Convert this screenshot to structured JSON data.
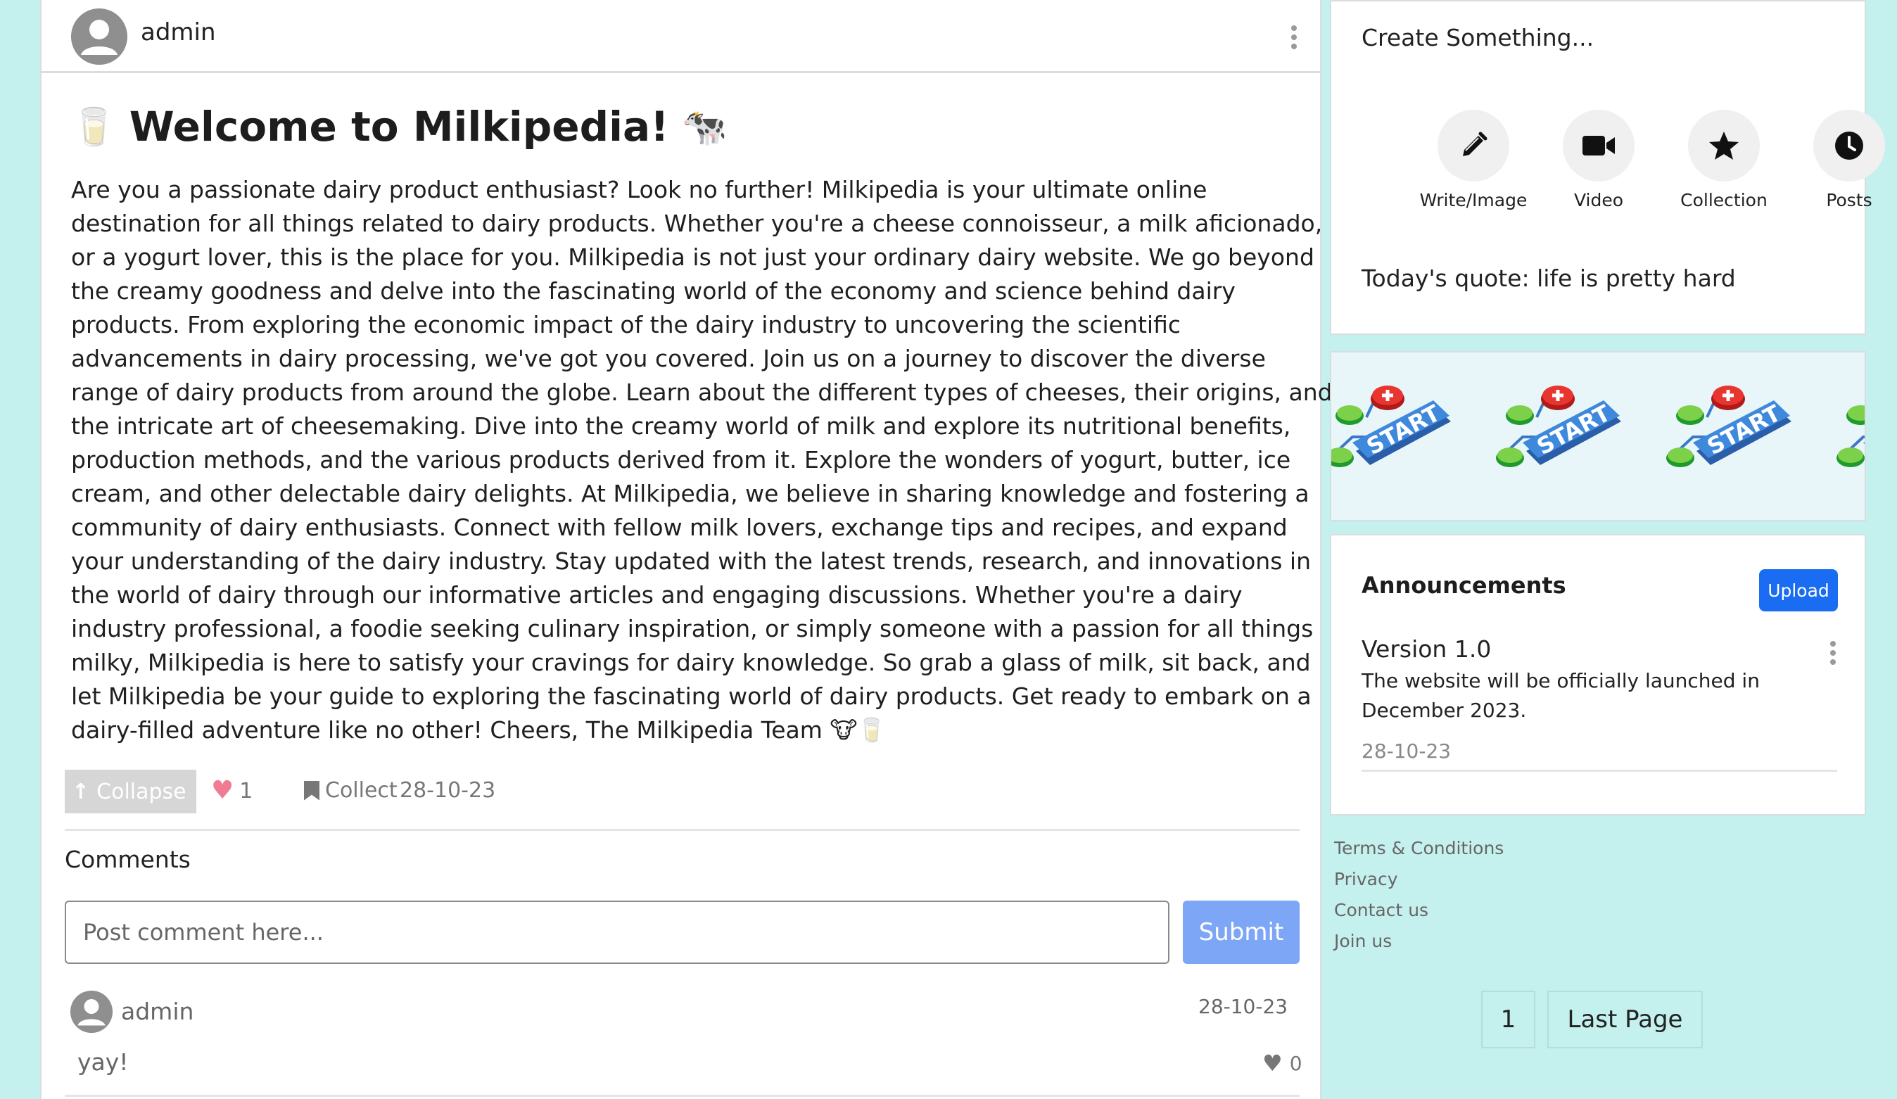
{
  "post": {
    "author": "admin",
    "title": "Welcome to Milkipedia!",
    "title_emoji_left": "🥛",
    "title_emoji_right": "🐄",
    "body": "Are you a passionate dairy product enthusiast? Look no further! Milkipedia is your ultimate online destination for all things related to dairy products. Whether you're a cheese connoisseur, a milk aficionado, or a yogurt lover, this is the place for you. Milkipedia is not just your ordinary dairy website. We go beyond the creamy goodness and delve into the fascinating world of the economy and science behind dairy products. From exploring the economic impact of the dairy industry to uncovering the scientific advancements in dairy processing, we've got you covered. Join us on a journey to discover the diverse range of dairy products from around the globe. Learn about the different types of cheeses, their origins, and the intricate art of cheesemaking. Dive into the creamy world of milk and explore its nutritional benefits, production methods, and the various products derived from it. Explore the wonders of yogurt, butter, ice cream, and other delectable dairy delights. At Milkipedia, we believe in sharing knowledge and fostering a community of dairy enthusiasts. Connect with fellow milk lovers, exchange tips and recipes, and expand your understanding of the dairy industry. Stay updated with the latest trends, research, and innovations in the world of dairy through our informative articles and engaging discussions. Whether you're a dairy industry professional, a foodie seeking culinary inspiration, or simply someone with a passion for all things milky, Milkipedia is here to satisfy your cravings for dairy knowledge. So grab a glass of milk, sit back, and let Milkipedia be your guide to exploring the fascinating world of dairy products. Get ready to embark on a dairy-filled adventure like no other! Cheers, The Milkipedia Team 🐮🥛",
    "collapse_label": "Collapse",
    "like_count": "1",
    "collect_label": "Collect",
    "date": "28-10-23"
  },
  "comments": {
    "title": "Comments",
    "input_placeholder": "Post comment here...",
    "submit_label": "Submit",
    "items": [
      {
        "author": "admin",
        "date": "28-10-23",
        "text": "yay!",
        "likes": "0"
      }
    ]
  },
  "create": {
    "title": "Create Something...",
    "items": [
      {
        "label": "Write/Image",
        "icon": "pencil-icon"
      },
      {
        "label": "Video",
        "icon": "video-camera-icon"
      },
      {
        "label": "Collection",
        "icon": "star-icon"
      },
      {
        "label": "Posts",
        "icon": "clock-icon"
      }
    ],
    "quote": "Today's quote: life is pretty hard"
  },
  "banner": {
    "label": "START"
  },
  "announcements": {
    "title": "Announcements",
    "upload_label": "Upload",
    "items": [
      {
        "version": "Version 1.0",
        "text": "The website will be officially launched in December 2023.",
        "date": "28-10-23"
      }
    ]
  },
  "footer": {
    "links": [
      "Terms & Conditions",
      "Privacy",
      "Contact us",
      "Join us"
    ]
  },
  "pagination": {
    "current": "1",
    "last_label": "Last Page"
  },
  "colors": {
    "background": "#c4f0ee",
    "upload_button": "#1a6df2",
    "submit_button": "#7ea6f7",
    "heart": "#f07c93"
  }
}
